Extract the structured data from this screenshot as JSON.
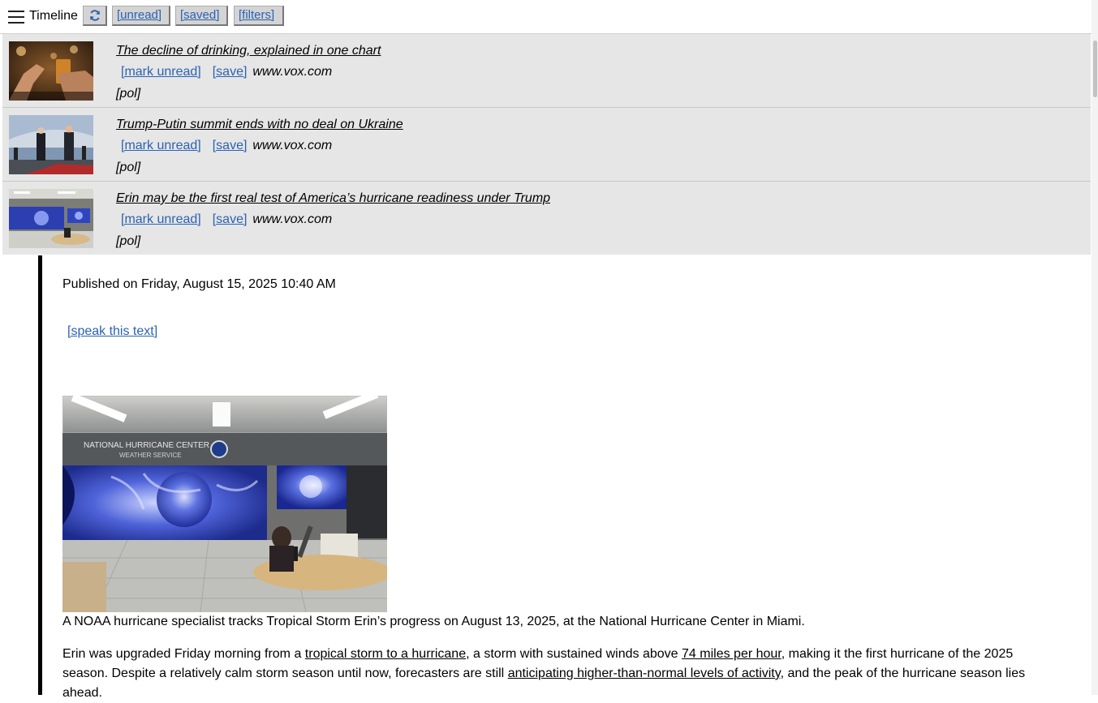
{
  "toolbar": {
    "title": "Timeline",
    "unread_label": "[unread]",
    "saved_label": "[saved]",
    "filters_label": "[filters]",
    "accent_color": "#2a62b3"
  },
  "feed": {
    "items": [
      {
        "title": "The decline of drinking, explained in one chart",
        "mark_unread": "[mark unread]",
        "save": "[save]",
        "domain": "www.vox.com",
        "tag": "[pol]"
      },
      {
        "title": "Trump-Putin summit ends with no deal on Ukraine",
        "mark_unread": "[mark unread]",
        "save": "[save]",
        "domain": "www.vox.com",
        "tag": "[pol]"
      },
      {
        "title": "Erin may be the first real test of America’s hurricane readiness under Trump",
        "mark_unread": "[mark unread]",
        "save": "[save]",
        "domain": "www.vox.com",
        "tag": "[pol]"
      }
    ]
  },
  "article": {
    "published": "Published on Friday, August 15, 2025 10:40 AM",
    "speak_label": "[speak this text]",
    "image_sign_line1": "NATIONAL HURRICANE CENTER",
    "image_sign_line2": "WEATHER SERVICE",
    "caption": "A NOAA hurricane specialist tracks Tropical Storm Erin’s progress on August 13, 2025, at the National Hurricane Center in Miami.",
    "para_t1": "Erin was upgraded Friday morning from a ",
    "para_link1": "tropical storm to a hurricane",
    "para_t2": ", a storm with sustained winds above ",
    "para_link2": "74 miles per hour",
    "para_t3": ", making it the first hurricane of the 2025 season. Despite a relatively calm storm season until now, forecasters are still ",
    "para_link3": "anticipating higher-than-normal levels of activity",
    "para_t4": ", and the peak of the hurricane season lies ahead."
  }
}
